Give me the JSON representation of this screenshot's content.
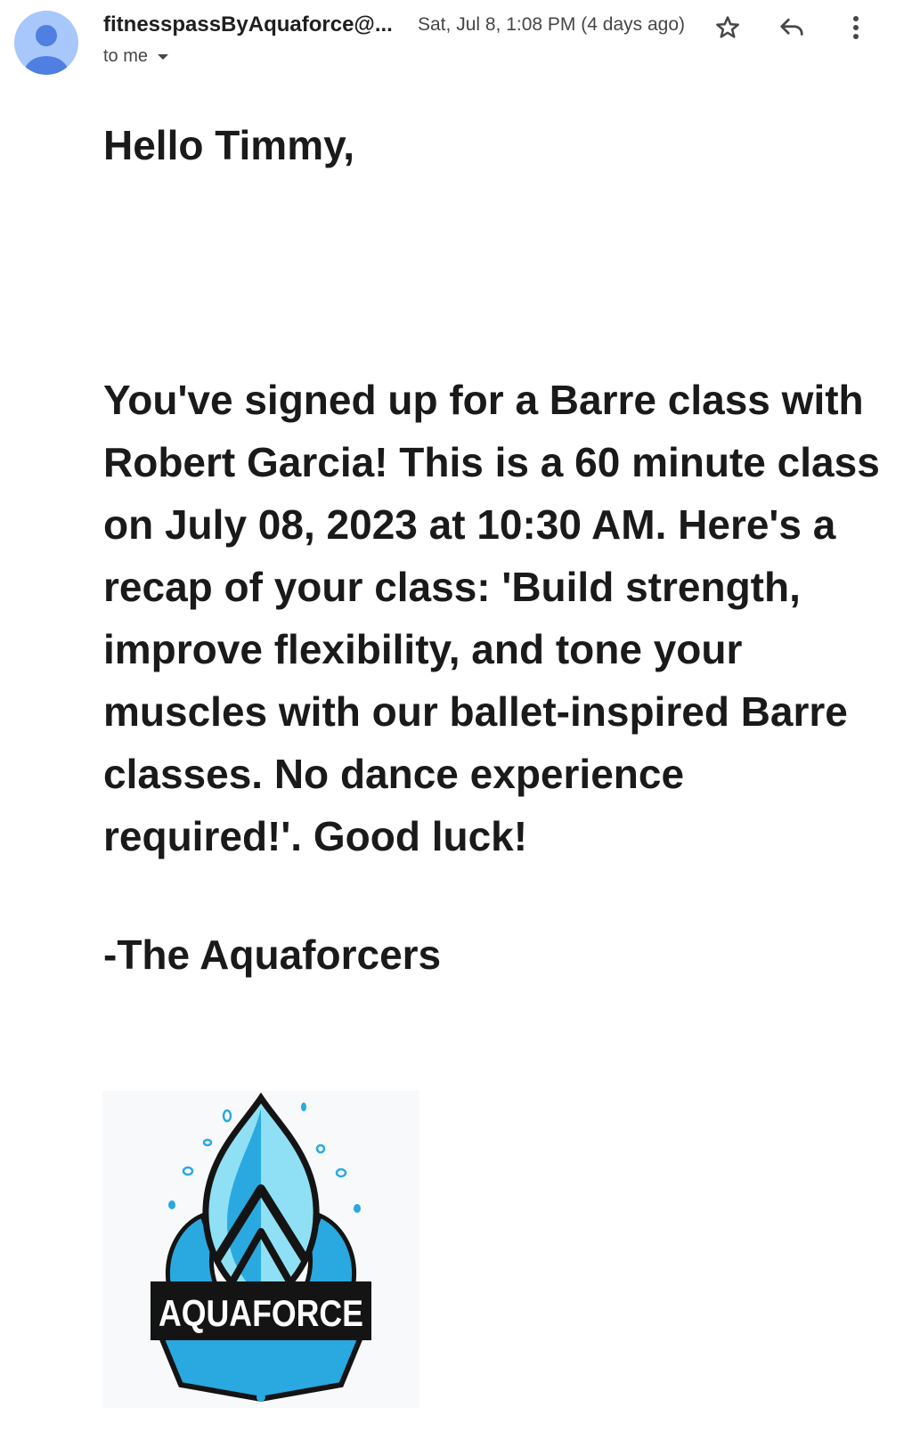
{
  "email": {
    "sender": "fitnesspassByAquaforce@...",
    "date": "Sat, Jul 8, 1:08 PM (4 days ago)",
    "recipient": "to me",
    "greeting": "Hello Timmy,",
    "message": "You've signed up for a Barre class with Robert Garcia! This is a 60 minute class on July 08, 2023 at 10:30 AM. Here's a recap of your class: 'Build strength, improve flexibility, and tone your muscles with our ballet-inspired Barre classes. No dance experience required!'. Good luck!",
    "signoff": "-The Aquaforcers",
    "logo_text": "AQUAFORCE"
  },
  "icons": {
    "avatar": "person-icon",
    "recipient_dropdown": "caret-down-icon",
    "star": "star-icon",
    "reply": "reply-icon",
    "more": "more-vertical-icon"
  },
  "colors": {
    "avatar_bg": "#a8c7fa",
    "avatar_figure": "#4f7fe0",
    "logo_blue": "#29a9e0",
    "logo_light": "#8fe0f5",
    "logo_dark": "#141414"
  }
}
